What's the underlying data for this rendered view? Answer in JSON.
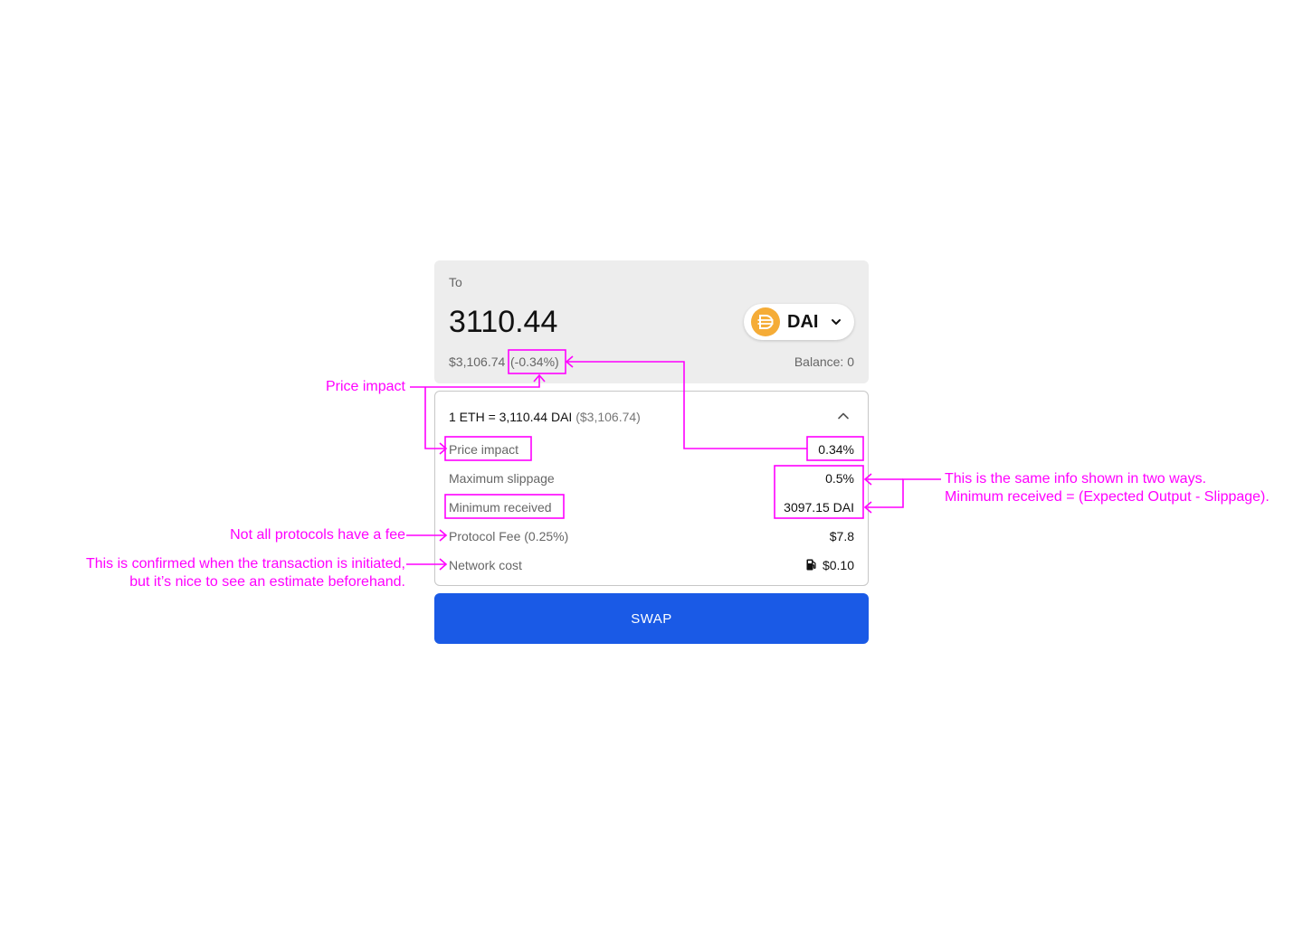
{
  "colors": {
    "annotation": "#ff00ff",
    "swap_button": "#1a5ae6",
    "dai_logo": "#f5ac37",
    "card_bg": "#ededed"
  },
  "to_panel": {
    "label": "To",
    "amount": "3110.44",
    "token": {
      "symbol": "DAI",
      "icon": "dai-logo",
      "dropdown_icon": "chevron-down-icon"
    },
    "usd_value": "$3,106.74",
    "price_change": "(-0.34%)",
    "balance": "Balance: 0"
  },
  "details": {
    "rate": "1 ETH = 3,110.44 DAI",
    "rate_usd": "($3,106.74)",
    "collapse_icon": "chevron-up-icon",
    "rows": [
      {
        "label": "Price impact",
        "value": "0.34%"
      },
      {
        "label": "Maximum slippage",
        "value": "0.5%"
      },
      {
        "label": "Minimum received",
        "value": "3097.15 DAI"
      },
      {
        "label": "Protocol Fee (0.25%)",
        "value": "$7.8"
      },
      {
        "label": "Network cost",
        "value": "$0.10",
        "icon": "gas-pump-icon"
      }
    ]
  },
  "swap_button": {
    "label": "SWAP"
  },
  "annotations": {
    "price_impact": "Price impact",
    "same_info_line1": "This is the same info shown in two ways.",
    "same_info_line2": "Minimum received = (Expected Output - Slippage).",
    "fee_note": "Not all protocols have a fee",
    "network_note_line1": "This is confirmed when the transaction is initiated,",
    "network_note_line2": "but it’s nice to see an estimate beforehand."
  }
}
